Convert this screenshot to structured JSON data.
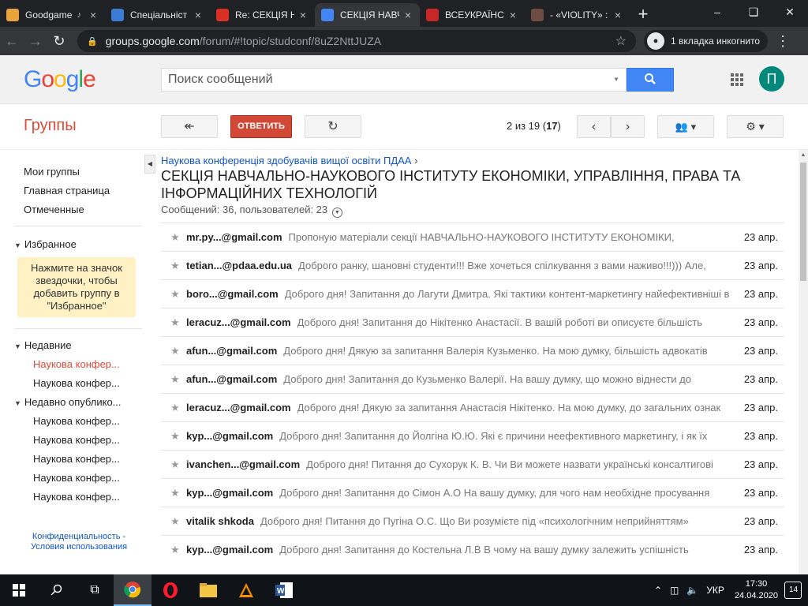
{
  "browser": {
    "tabs": [
      {
        "title": "Goodgame",
        "color": "#e8a33d",
        "audio": true
      },
      {
        "title": "Спеціальніст",
        "color": "#3a7bd5"
      },
      {
        "title": "Re: СЕКЦІЯ Н",
        "color": "#d93025"
      },
      {
        "title": "СЕКЦІЯ НАВЧ",
        "color": "#4285f4",
        "active": true
      },
      {
        "title": "ВСЕУКРАЇНС",
        "color": "#c62828"
      },
      {
        "title": "- «VIOLITY» :",
        "color": "#6d4c41"
      }
    ],
    "new_tab": "+",
    "url_host": "groups.google.com",
    "url_path": "/forum/#!topic/studconf/8uZ2NttJUZA",
    "incognito_label": "1 вкладка инкогнито"
  },
  "header": {
    "search_placeholder": "Поиск сообщений",
    "avatar_letter": "П"
  },
  "toolbar": {
    "app_title": "Группы",
    "reply_label": "ОТВЕТИТЬ",
    "pager_prefix": "2 из 19 (",
    "pager_total": "17",
    "pager_suffix": ")"
  },
  "sidebar": {
    "nav": [
      "Мои группы",
      "Главная страница",
      "Отмеченные"
    ],
    "favorites_title": "Избранное",
    "favorites_hint": "Нажмите на значок звездочки, чтобы добавить группу в \"Избранное\"",
    "recent_title": "Недавние",
    "recent_items": [
      "Наукова конфер...",
      "Наукова конфер..."
    ],
    "published_title": "Недавно опублико...",
    "published_items": [
      "Наукова конфер...",
      "Наукова конфер...",
      "Наукова конфер...",
      "Наукова конфер...",
      "Наукова конфер..."
    ],
    "privacy": "Конфиденциальность -",
    "terms": "Условия использования"
  },
  "topic": {
    "breadcrumb": "Наукова конференція здобувачів вищої освіти ПДАА",
    "title": "СЕКЦІЯ НАВЧАЛЬНО-НАУКОВОГО ІНСТИТУТУ ЕКОНОМІКИ, УПРАВЛІННЯ, ПРАВА ТА ІНФОРМАЦІЙНИХ ТЕХНОЛОГІЙ",
    "meta": "Сообщений: 36, пользователей: 23"
  },
  "messages": [
    {
      "author": "mr.py...@gmail.com",
      "snippet": "Пропоную матеріали секції НАВЧАЛЬНО-НАУКОВОГО ІНСТИТУТУ ЕКОНОМІКИ,",
      "date": "23 апр."
    },
    {
      "author": "tetian...@pdaa.edu.ua",
      "snippet": "Доброго ранку, шановні студенти!!! Вже хочеться спілкування з вами наживо!!!))) Але,",
      "date": "23 апр."
    },
    {
      "author": "boro...@gmail.com",
      "snippet": "Доброго дня! Запитання до Лагути Дмитра. Які тактики контент-маркетингу найефективніші в",
      "date": "23 апр."
    },
    {
      "author": "leracuz...@gmail.com",
      "snippet": "Доброго дня! Запитання до Нікітенко Анастасії. В вашій роботі ви описуєте більшість",
      "date": "23 апр."
    },
    {
      "author": "afun...@gmail.com",
      "snippet": "Доброго дня! Дякую за запитання Валерія Кузьменко. На мою думку, більшість адвокатів",
      "date": "23 апр."
    },
    {
      "author": "afun...@gmail.com",
      "snippet": "Доброго дня! Запитання до Кузьменко Валерії. На вашу думку, що можно віднести до",
      "date": "23 апр."
    },
    {
      "author": "leracuz...@gmail.com",
      "snippet": "Доброго дня! Дякую за запитання Анастасія Нікітенко. На мою думку, до загальних ознак",
      "date": "23 апр."
    },
    {
      "author": "kyp...@gmail.com",
      "snippet": "Доброго дня! Запитання до Йолгіна Ю.Ю. Які є причини неефективного маркетингу, і як їх",
      "date": "23 апр."
    },
    {
      "author": "ivanchen...@gmail.com",
      "snippet": "Доброго дня! Питання до Сухорук К. В. Чи Ви можете назвати українські консалтигові",
      "date": "23 апр."
    },
    {
      "author": "kyp...@gmail.com",
      "snippet": "Доброго дня! Запитання до Сімон А.О На вашу думку, для чого нам необхідне просування",
      "date": "23 апр."
    },
    {
      "author": "vitalik shkoda",
      "snippet": "Доброго дня! Питання до Пугіна О.С. Що Ви розумієте під «психологічним неприйняттям»",
      "date": "23 апр."
    },
    {
      "author": "kyp...@gmail.com",
      "snippet": "Доброго дня! Запитання до Костельна Л.В В чому на вашу думку залежить успішність",
      "date": "23 апр."
    }
  ],
  "taskbar": {
    "language": "УКР",
    "time": "17:30",
    "date": "24.04.2020",
    "notifications": "14"
  }
}
